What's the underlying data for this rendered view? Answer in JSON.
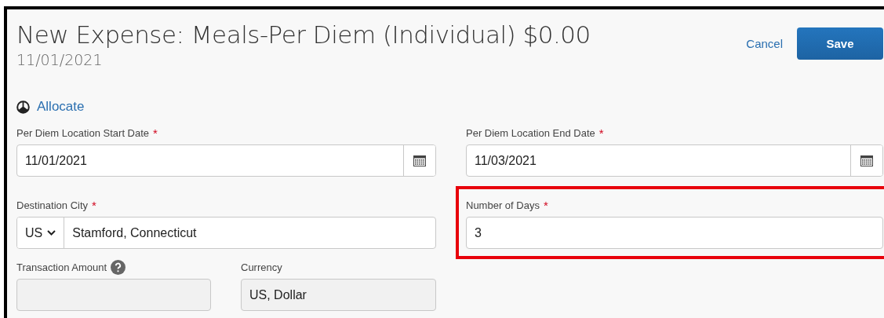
{
  "header": {
    "title": "New Expense: Meals-Per Diem (Individual) $0.00",
    "date": "11/01/2021",
    "cancel": "Cancel",
    "save": "Save"
  },
  "allocate": "Allocate",
  "location_dates": [
    {
      "kind": "date",
      "label": "Per Diem Location Start Date",
      "required_mark": "*",
      "value": "11/01/2021"
    },
    {
      "kind": "date",
      "label": "Per Diem Location End Date",
      "required_mark": "*",
      "value": "11/03/2021"
    }
  ],
  "destination": {
    "kind": "city",
    "label": "Destination City",
    "required_mark": "*",
    "country": "US",
    "value": "Stamford, Connecticut"
  },
  "number_of_days": {
    "kind": "text",
    "label": "Number of Days",
    "required_mark": "*",
    "value": "3",
    "highlighted": true
  },
  "amounts": [
    {
      "kind": "text",
      "label": "Transaction Amount",
      "help": true,
      "disabled": true
    },
    {
      "kind": "text",
      "label": "Currency",
      "disabled": true,
      "value": "US, Dollar"
    }
  ]
}
